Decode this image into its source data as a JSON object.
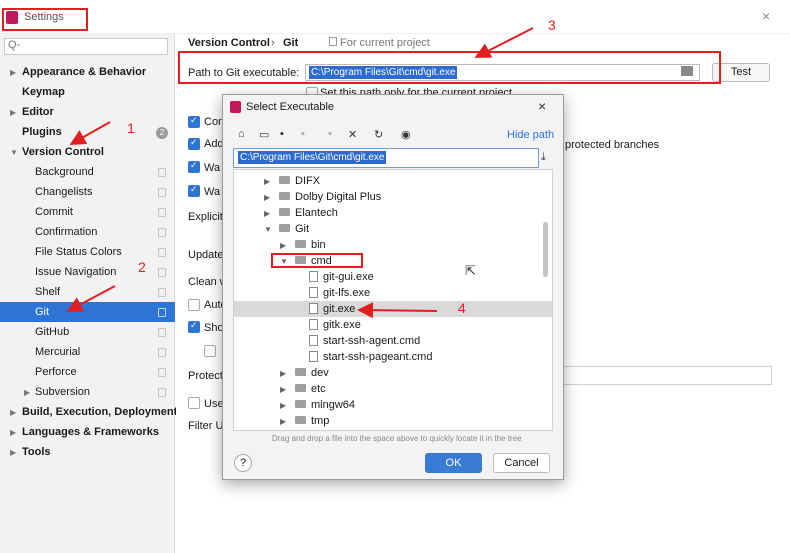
{
  "window": {
    "title": "Settings",
    "close": "×"
  },
  "search": {
    "icon": "search-icon",
    "placeholder": "Q-"
  },
  "sidebar": [
    {
      "label": "Appearance & Behavior",
      "bold": true,
      "caret": "▶"
    },
    {
      "label": "Keymap",
      "bold": true
    },
    {
      "label": "Editor",
      "bold": true,
      "caret": "▶"
    },
    {
      "label": "Plugins",
      "bold": true,
      "badge": "2"
    },
    {
      "label": "Version Control",
      "bold": true,
      "caret": "▼"
    },
    {
      "label": "Background"
    },
    {
      "label": "Changelists"
    },
    {
      "label": "Commit"
    },
    {
      "label": "Confirmation"
    },
    {
      "label": "File Status Colors"
    },
    {
      "label": "Issue Navigation"
    },
    {
      "label": "Shelf"
    },
    {
      "label": "Git",
      "selected": true
    },
    {
      "label": "GitHub"
    },
    {
      "label": "Mercurial"
    },
    {
      "label": "Perforce"
    },
    {
      "label": "Subversion",
      "caret": "▶"
    },
    {
      "label": "Build, Execution, Deployment",
      "bold": true,
      "caret": "▶"
    },
    {
      "label": "Languages & Frameworks",
      "bold": true,
      "caret": "▶"
    },
    {
      "label": "Tools",
      "bold": true,
      "caret": "▶"
    }
  ],
  "breadcrumb": {
    "part1": "Version Control",
    "sep": "›",
    "part2": "Git",
    "scope": "For current project"
  },
  "git": {
    "path_label": "Path to Git executable:",
    "path_value": "C:\\Program Files\\Git\\cmd\\git.exe",
    "test_label": "Test",
    "set_path_label": "Set this path only for the current project",
    "truncated": [
      "Com",
      "Add",
      "Wa",
      "Wa",
      "Explicit",
      "Update",
      "Clean w",
      "Auto",
      "Sho",
      "Protect",
      "Use",
      "Filter U"
    ],
    "protected_branches": "protected branches"
  },
  "dialog": {
    "title": "Select Executable",
    "close": "×",
    "hide_path": "Hide path",
    "path_value": "C:\\Program Files\\Git\\cmd\\git.exe",
    "toolbar": [
      "home-icon",
      "desktop-icon",
      "project-icon",
      "module-icon",
      "new-folder-icon",
      "delete-icon",
      "refresh-icon",
      "show-hidden-icon"
    ],
    "tree": [
      {
        "label": "DIFX",
        "type": "folder",
        "caret": "▶"
      },
      {
        "label": "Dolby Digital Plus",
        "type": "folder",
        "caret": "▶"
      },
      {
        "label": "Elantech",
        "type": "folder",
        "caret": "▶"
      },
      {
        "label": "Git",
        "type": "folder",
        "caret": "▼"
      },
      {
        "label": "bin",
        "type": "folder",
        "caret": "▶"
      },
      {
        "label": "cmd",
        "type": "folder",
        "caret": "▼"
      },
      {
        "label": "git-gui.exe",
        "type": "file"
      },
      {
        "label": "git-lfs.exe",
        "type": "file"
      },
      {
        "label": "git.exe",
        "type": "file",
        "selected": true
      },
      {
        "label": "gitk.exe",
        "type": "file"
      },
      {
        "label": "start-ssh-agent.cmd",
        "type": "file"
      },
      {
        "label": "start-ssh-pageant.cmd",
        "type": "file"
      },
      {
        "label": "dev",
        "type": "folder",
        "caret": "▶"
      },
      {
        "label": "etc",
        "type": "folder",
        "caret": "▶"
      },
      {
        "label": "mingw64",
        "type": "folder",
        "caret": "▶"
      },
      {
        "label": "tmp",
        "type": "folder",
        "caret": "▶"
      }
    ],
    "hint": "Drag and drop a file into the space above to quickly locate it in the tree",
    "help": "?",
    "ok": "OK",
    "cancel": "Cancel"
  },
  "annotations": [
    "1",
    "2",
    "3",
    "4"
  ],
  "colors": {
    "selection": "#2d74d6",
    "annotation": "#e02020",
    "ok_button": "#3a7bd5"
  }
}
